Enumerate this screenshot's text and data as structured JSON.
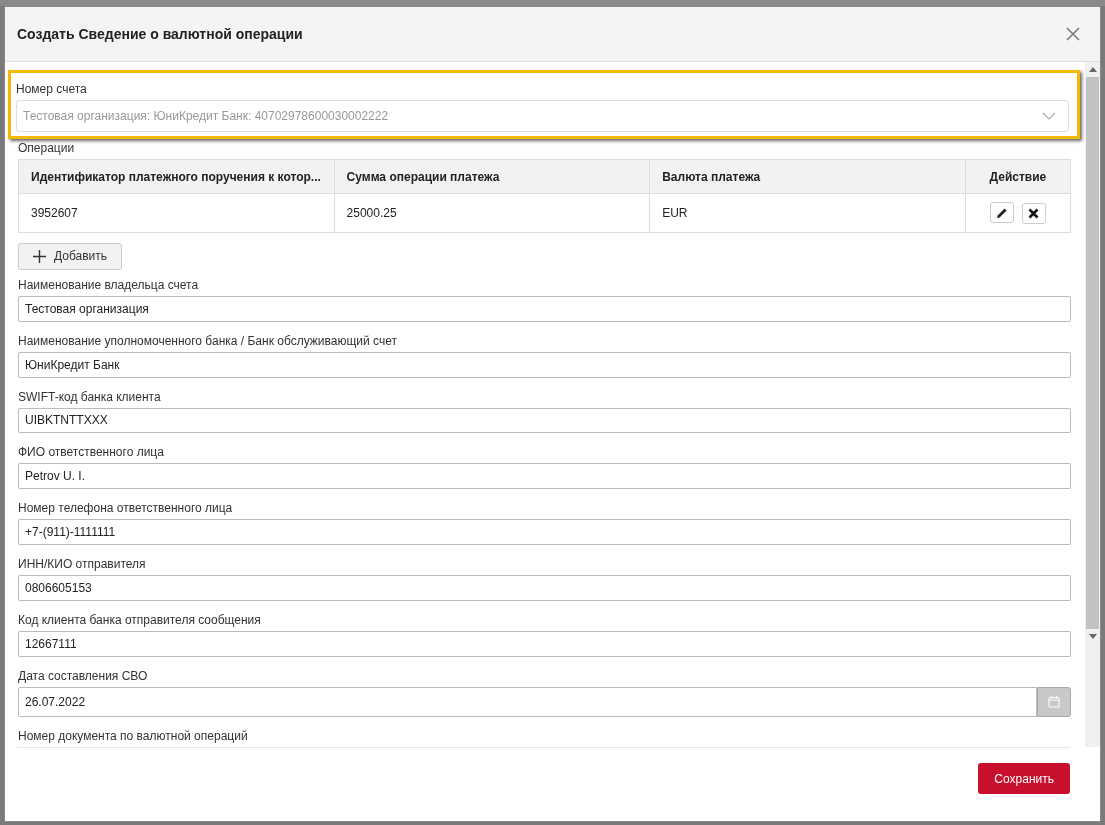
{
  "dialog": {
    "title": "Создать Сведение о валютной операции"
  },
  "account": {
    "label": "Номер счета",
    "value": "Тестовая организация: ЮниКредит Банк: 40702978600030002222",
    "highlighted": true,
    "disabled": true
  },
  "operations": {
    "label": "Операции",
    "columns": [
      "Идентификатор платежного поручения к котор...",
      "Сумма операции платежа",
      "Валюта платежа",
      "Действие"
    ],
    "rows": [
      {
        "cells": [
          "3952607",
          "25000.25",
          "EUR"
        ]
      }
    ],
    "add_button": "Добавить"
  },
  "fields": [
    {
      "kind": "text",
      "label": "Наименование владельца счета",
      "value": "Тестовая организация"
    },
    {
      "kind": "text",
      "label": "Наименование уполномоченного банка / Банк обслуживающий счет",
      "value": "ЮниКредит Банк"
    },
    {
      "kind": "text",
      "label": "SWIFT-код банка клиента",
      "value": "UIBKTNTTXXX"
    },
    {
      "kind": "text",
      "label": "ФИО ответственного лица",
      "value": "Petrov U. I."
    },
    {
      "kind": "text",
      "label": "Номер телефона ответственного лица",
      "value": "+7-(911)-1111111"
    },
    {
      "kind": "text",
      "label": "ИНН/КИО отправителя",
      "value": "0806605153"
    },
    {
      "kind": "text",
      "label": "Код клиента банка отправителя сообщения",
      "value": "12667111"
    },
    {
      "kind": "date",
      "label": "Дата составления СВО",
      "value": "26.07.2022"
    },
    {
      "kind": "label",
      "label": "Номер документа по валютной операций"
    }
  ],
  "save_button": "Сохранить"
}
